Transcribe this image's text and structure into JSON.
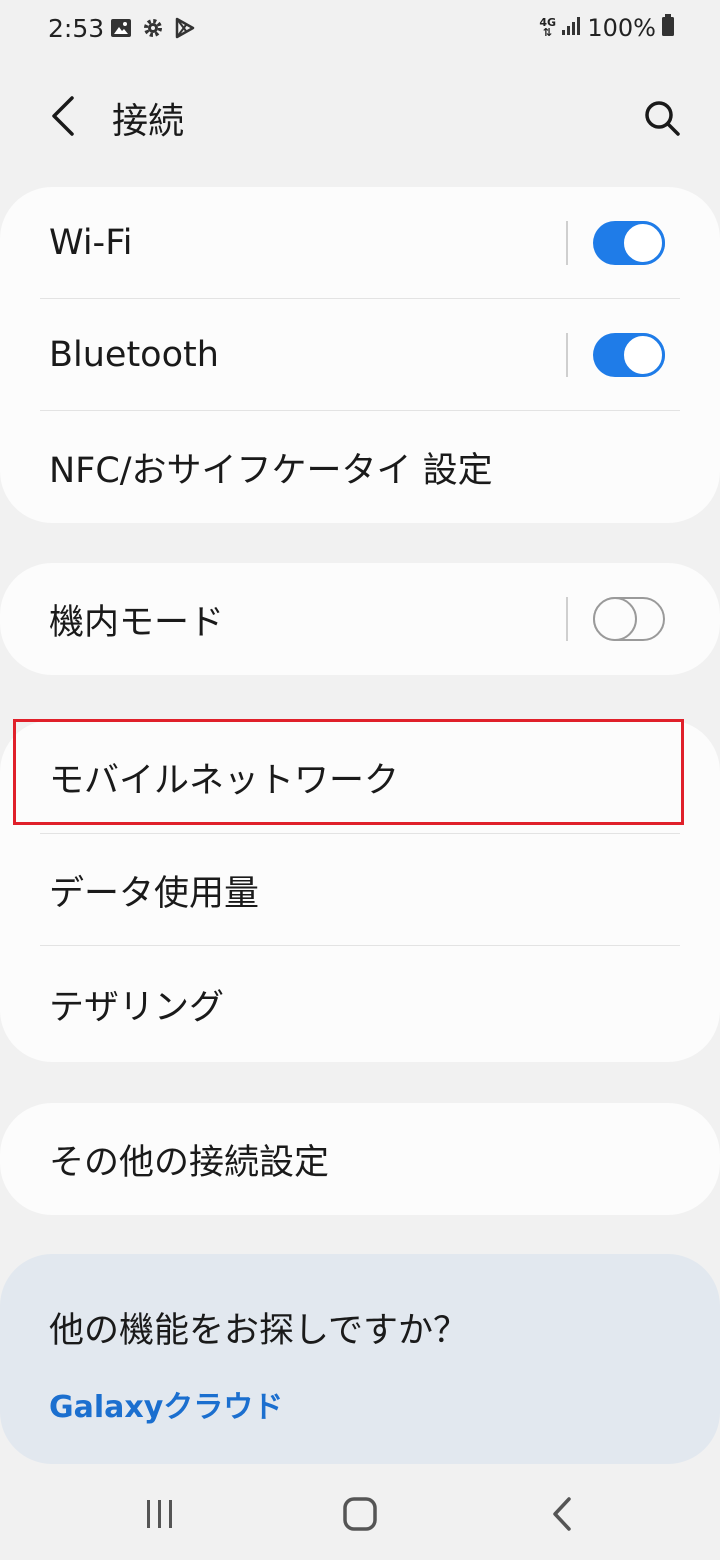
{
  "status_bar": {
    "time": "2:53",
    "battery": "100%",
    "network": "4G",
    "icons": [
      "image-icon",
      "gear-icon",
      "play-store-icon",
      "signal-icon",
      "battery-icon"
    ]
  },
  "header": {
    "title": "接続",
    "back_icon": "chevron-left-icon",
    "search_icon": "search-icon"
  },
  "groups": [
    {
      "items": [
        {
          "label": "Wi-Fi",
          "toggle": true
        },
        {
          "label": "Bluetooth",
          "toggle": true
        },
        {
          "label": "NFC/おサイフケータイ 設定"
        }
      ]
    },
    {
      "items": [
        {
          "label": "機内モード",
          "toggle": false
        }
      ]
    },
    {
      "items": [
        {
          "label": "モバイルネットワーク",
          "highlighted": true
        },
        {
          "label": "データ使用量"
        },
        {
          "label": "テザリング"
        }
      ]
    },
    {
      "items": [
        {
          "label": "その他の接続設定"
        }
      ]
    }
  ],
  "suggestions": {
    "title": "他の機能をお探しですか？",
    "links": [
      "Galaxyクラウド"
    ]
  },
  "nav_bar": {
    "icons": [
      "recents-icon",
      "home-icon",
      "back-icon"
    ]
  },
  "colors": {
    "accent": "#1f7ce8",
    "highlight_border": "#e0202a",
    "background": "#f1f1f1",
    "card": "#fcfcfc",
    "suggestion_bg": "#e2e8ef",
    "link": "#1b6fcf"
  }
}
